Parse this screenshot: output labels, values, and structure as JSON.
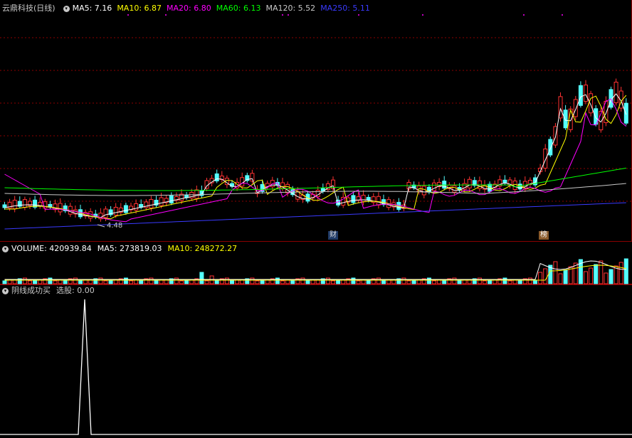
{
  "price_panel": {
    "name": "云鼎科技(日线)",
    "ma": [
      {
        "label": "MA5: 7.16",
        "color": "#ffffff"
      },
      {
        "label": "MA10: 6.87",
        "color": "#ffff00"
      },
      {
        "label": "MA20: 6.80",
        "color": "#ff00ff"
      },
      {
        "label": "MA60: 6.13",
        "color": "#00ff00"
      },
      {
        "label": "MA120: 5.52",
        "color": "#c8c8c8"
      },
      {
        "label": "MA250: 5.11",
        "color": "#3a3aff"
      }
    ],
    "low_label": "4.48",
    "tag_cai": "财",
    "tag_bang": "榜"
  },
  "volume_panel": {
    "items": [
      {
        "label": "VOLUME: 420939.84",
        "color": "#ffffff"
      },
      {
        "label": "MA5: 273819.03",
        "color": "#ffffff"
      },
      {
        "label": "MA10: 248272.27",
        "color": "#ffff00"
      }
    ]
  },
  "indicator_panel": {
    "name": "阴线成功买",
    "value_label": "选股: 0.00"
  },
  "colors": {
    "up": "#ff3232",
    "down": "#54ffff",
    "grid": "#8b0000",
    "bg": "#000000"
  }
}
